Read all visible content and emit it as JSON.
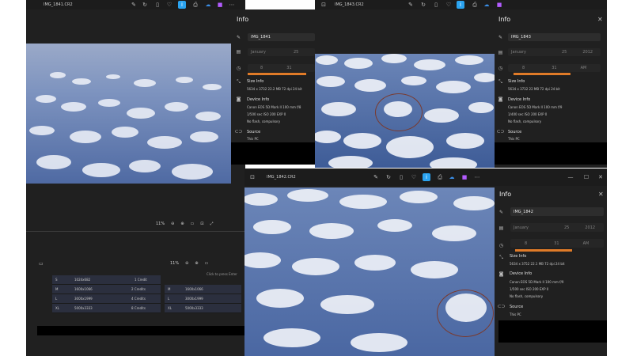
{
  "windows": {
    "w1": {
      "filename": "IMG_1841.CR2",
      "zoom": "11%"
    },
    "w2": {
      "filename": "IMG_1843.CR2"
    },
    "w3": {
      "filename": "IMG_1842.CR2"
    }
  },
  "bg_window": {
    "zoom": "11%",
    "search_placeholder": "Click to press Enter"
  },
  "size_table": [
    {
      "code": "S",
      "dims": "1024x682",
      "credits": "1 Credit"
    },
    {
      "code": "M",
      "dims": "1600x1066",
      "credits": "2 Credits"
    },
    {
      "code": "L",
      "dims": "3000x1999",
      "credits": "4 Credits"
    },
    {
      "code": "XL",
      "dims": "5000x3333",
      "credits": "8 Credits"
    }
  ],
  "size_table_right": [
    {
      "code": "M",
      "dims": "1600x1066"
    },
    {
      "code": "L",
      "dims": "3000x1999"
    },
    {
      "code": "XL",
      "dims": "5000x3333"
    }
  ],
  "info_panels": {
    "p1": {
      "title": "Info",
      "name": "IMG_1841",
      "month": "January",
      "day": "25",
      "hour": "8",
      "minute": "31",
      "size_title": "Size Info",
      "size_line": "5634 x 3732   22.2 MB   72 dpi   24 bit",
      "device_title": "Device Info",
      "device_line1": "Canon   EOS 5D Mark II   100 mm   f/8",
      "device_line2": "1/500 sec   ISO 200   EXP 0",
      "device_line3": "No flash, compulsory",
      "source_title": "Source",
      "source_line": "This PC"
    },
    "p2": {
      "title": "Info",
      "name": "IMG_1843",
      "month": "January",
      "day": "25",
      "year": "2012",
      "hour": "8",
      "minute": "31",
      "ampm": "AM",
      "size_title": "Size Info",
      "size_line": "5634 x 3732   22 MB   72 dpi   24 bit",
      "device_title": "Device Info",
      "device_line1": "Canon   EOS 5D Mark II   100 mm   f/9",
      "device_line2": "1/400 sec   ISO 200   EXP 0",
      "device_line3": "No flash, compulsory",
      "source_title": "Source",
      "source_line": "This PC"
    },
    "p3": {
      "title": "Info",
      "name": "IMG_1842",
      "month": "January",
      "day": "25",
      "year": "2012",
      "hour": "8",
      "minute": "31",
      "ampm": "AM",
      "size_title": "Size Info",
      "size_line": "5634 x 3752   22.1 MB   72 dpi   24 bit",
      "device_title": "Device Info",
      "device_line1": "Canon   EOS 5D Mark II   100 mm   f/9",
      "device_line2": "1/500 sec   ISO 200   EXP 0",
      "device_line3": "No flash, compulsory",
      "source_title": "Source",
      "source_line": "This PC"
    }
  },
  "icons": {
    "close": "✕",
    "minimize": "—",
    "maximize": "☐",
    "more": "•••",
    "heart": "♡",
    "info": "ⓘ",
    "trash": "🗑",
    "rotate": "↻",
    "crop": "⧉"
  },
  "colors": {
    "accent": "#2aa3f0",
    "orange": "#e07b28",
    "annotation": "#7a3a2e"
  }
}
